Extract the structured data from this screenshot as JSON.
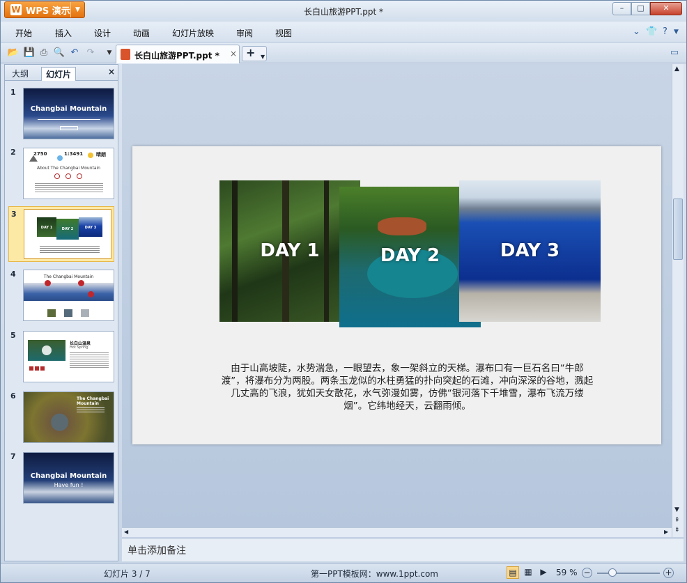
{
  "app": {
    "button_label": "WPS 演示",
    "window_title": "长白山旅游PPT.ppt *"
  },
  "window_controls": {
    "minimize": "–",
    "maximize": "□",
    "close": "✕"
  },
  "menu": {
    "items": [
      "开始",
      "插入",
      "设计",
      "动画",
      "幻灯片放映",
      "审阅",
      "视图"
    ]
  },
  "toolbar": {
    "icons": [
      "open-icon",
      "save-icon",
      "print-icon",
      "print-preview-icon",
      "undo-icon",
      "redo-icon"
    ]
  },
  "document_tab": {
    "name": "长白山旅游PPT.ppt *",
    "close": "×",
    "new_tab": "+"
  },
  "left_panel": {
    "tabs": [
      "大纲",
      "幻灯片"
    ],
    "close": "×",
    "thumbnails": [
      {
        "num": "1",
        "title": "Changbai Mountain"
      },
      {
        "num": "2",
        "stats": [
          "2750",
          "1:3491",
          "晴朗"
        ],
        "heading": "About The Changbai Mountain"
      },
      {
        "num": "3",
        "labels": [
          "DAY 1",
          "DAY 2",
          "DAY 3"
        ]
      },
      {
        "num": "4",
        "heading": "The Changbai Mountain"
      },
      {
        "num": "5",
        "heading": "长白山温泉",
        "sub": "Hot Spring"
      },
      {
        "num": "6",
        "heading": "The Changbai Mountain"
      },
      {
        "num": "7",
        "title": "Changbai Mountain",
        "sub": "Have fun !"
      }
    ]
  },
  "slide": {
    "days": [
      "DAY 1",
      "DAY 2",
      "DAY 3"
    ],
    "body": "由于山高坡陡，水势湍急，一眼望去，象一架斜立的天梯。瀑布口有一巨石名曰“牛郎渡”，将瀑布分为两股。两条玉龙似的水柱勇猛的扑向突起的石滩，冲向深深的谷地，溅起几丈高的飞浪，犹如天女散花，水气弥漫如雾，仿佛“银河落下千堆雪，瀑布飞流万缕烟”。它纬地经天，云翻雨倾。"
  },
  "notes": {
    "placeholder": "单击添加备注"
  },
  "status": {
    "slide_counter": "幻灯片 3 / 7",
    "site": "第一PPT模板网：www.1ppt.com",
    "zoom": "59 %"
  }
}
